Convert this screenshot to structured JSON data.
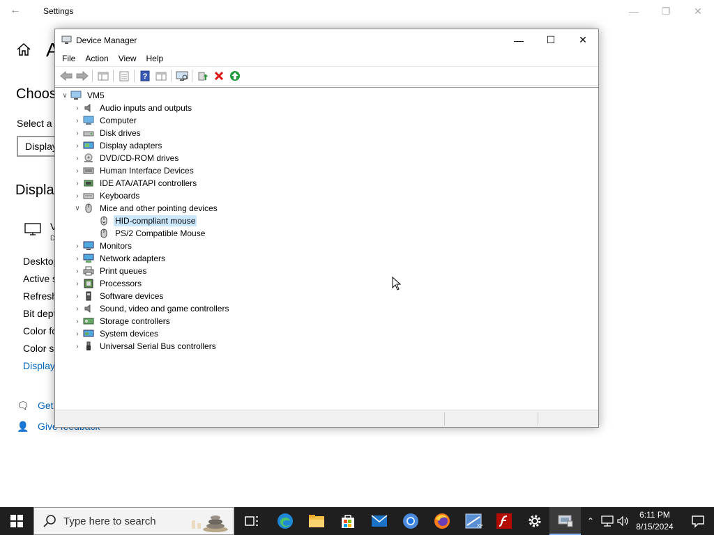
{
  "settings": {
    "title": "Settings",
    "heading_partial": "A",
    "choose_partial": "Choos",
    "select_partial": "Select a",
    "dropdown_partial": "Display",
    "display_partial": "Display",
    "monitor_partial": "V",
    "monitor_sub_partial": "D",
    "info_items": [
      "Desktop",
      "Active s",
      "Refresh",
      "Bit dept",
      "Color fo",
      "Color sp"
    ],
    "info_link": "Display",
    "help_get": "Get",
    "help_feedback": "Give feedback"
  },
  "device_manager": {
    "title": "Device Manager",
    "menu": [
      "File",
      "Action",
      "View",
      "Help"
    ],
    "root": "VM5",
    "categories": [
      {
        "label": "Audio inputs and outputs",
        "icon": "speaker-icon"
      },
      {
        "label": "Computer",
        "icon": "computer-icon"
      },
      {
        "label": "Disk drives",
        "icon": "disk-drive-icon"
      },
      {
        "label": "Display adapters",
        "icon": "display-adapter-icon"
      },
      {
        "label": "DVD/CD-ROM drives",
        "icon": "dvd-drive-icon"
      },
      {
        "label": "Human Interface Devices",
        "icon": "hid-icon"
      },
      {
        "label": "IDE ATA/ATAPI controllers",
        "icon": "ide-controller-icon"
      },
      {
        "label": "Keyboards",
        "icon": "keyboard-icon"
      },
      {
        "label": "Mice and other pointing devices",
        "icon": "mouse-icon",
        "expanded": true
      },
      {
        "label": "Monitors",
        "icon": "monitor-icon"
      },
      {
        "label": "Network adapters",
        "icon": "network-adapter-icon"
      },
      {
        "label": "Print queues",
        "icon": "printer-icon"
      },
      {
        "label": "Processors",
        "icon": "processor-icon"
      },
      {
        "label": "Software devices",
        "icon": "software-device-icon"
      },
      {
        "label": "Sound, video and game controllers",
        "icon": "sound-controller-icon"
      },
      {
        "label": "Storage controllers",
        "icon": "storage-controller-icon"
      },
      {
        "label": "System devices",
        "icon": "system-device-icon"
      },
      {
        "label": "Universal Serial Bus controllers",
        "icon": "usb-icon"
      }
    ],
    "mice_children": [
      {
        "label": "HID-compliant mouse",
        "selected": true
      },
      {
        "label": "PS/2 Compatible Mouse",
        "selected": false
      }
    ]
  },
  "taskbar": {
    "search_placeholder": "Type here to search",
    "apps": [
      "task-view",
      "edge",
      "file-explorer",
      "store",
      "mail",
      "chrome",
      "firefox",
      "app-xp",
      "flash",
      "settings",
      "device-manager"
    ],
    "time": "6:11 PM",
    "date": "8/15/2024"
  },
  "colors": {
    "selection": "#cce8ff",
    "link": "#0067c0",
    "taskbar": "#1f1f1f"
  }
}
